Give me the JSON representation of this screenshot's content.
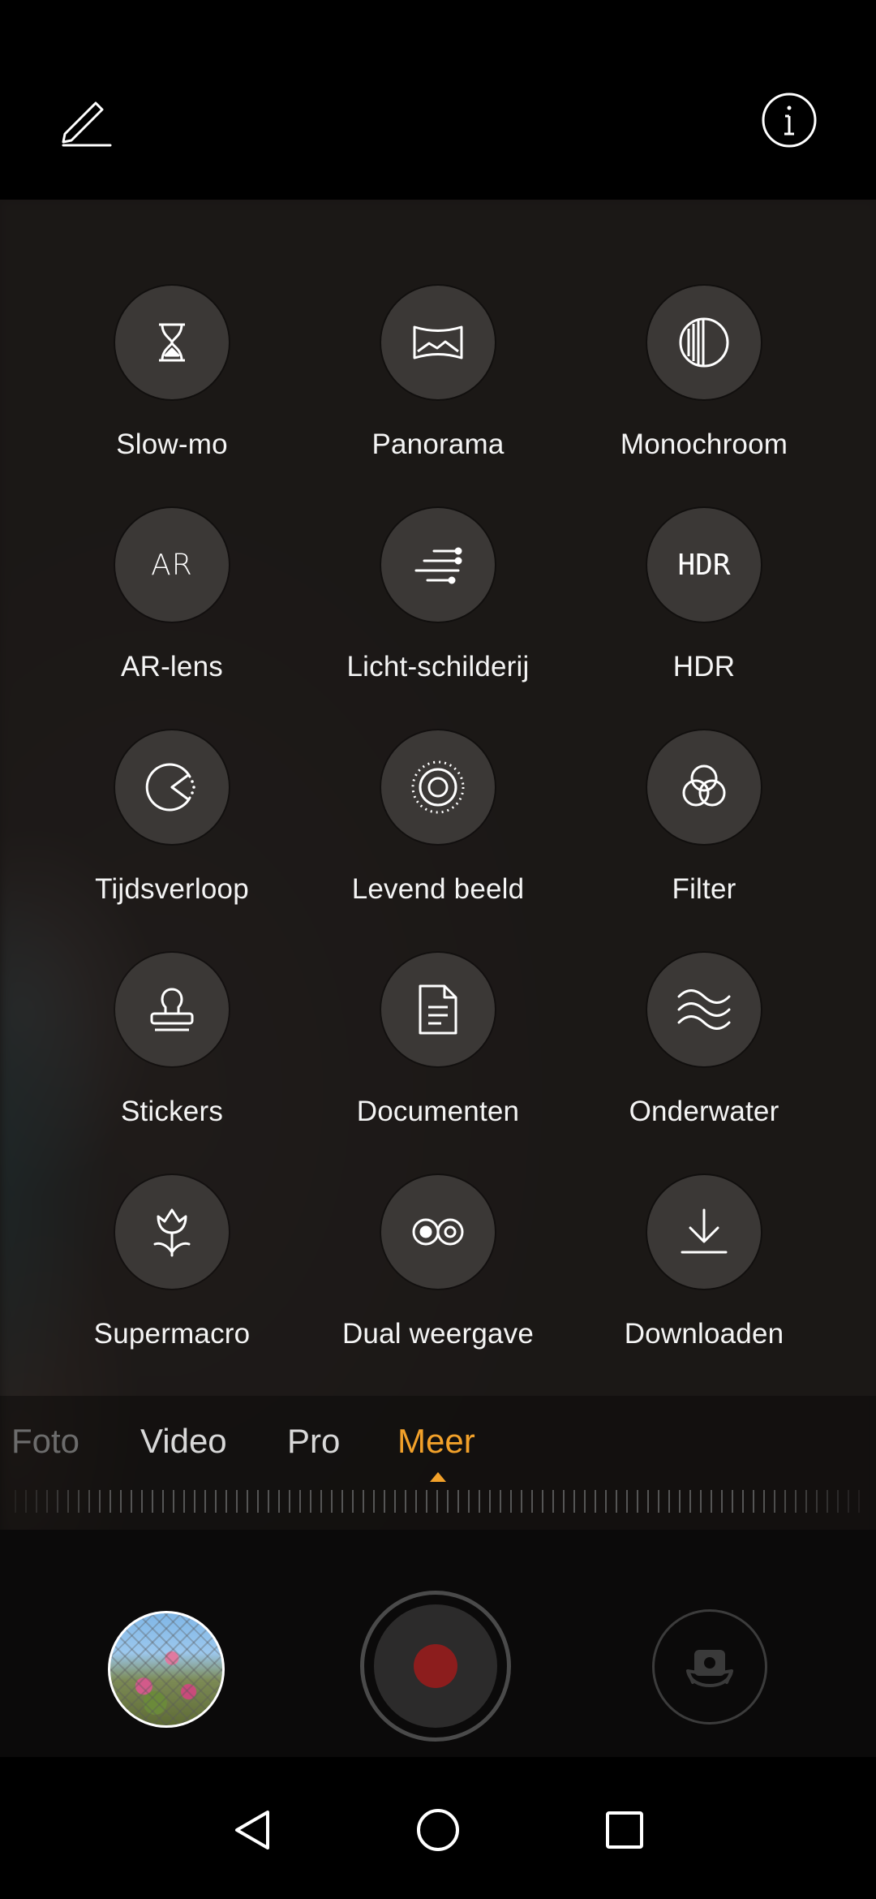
{
  "top_bar": {
    "edit_icon": "pencil-icon",
    "info_icon": "info-icon"
  },
  "modes": [
    {
      "label": "Slow-mo",
      "icon": "hourglass-icon"
    },
    {
      "label": "Panorama",
      "icon": "panorama-icon"
    },
    {
      "label": "Monochroom",
      "icon": "monochrome-icon"
    },
    {
      "label": "AR-lens",
      "icon": "ar-icon"
    },
    {
      "label": "Licht-schilderij",
      "icon": "light-trails-icon"
    },
    {
      "label": "HDR",
      "icon": "hdr-icon"
    },
    {
      "label": "Tijdsverloop",
      "icon": "timelapse-icon"
    },
    {
      "label": "Levend beeld",
      "icon": "live-photo-icon"
    },
    {
      "label": "Filter",
      "icon": "filter-circles-icon"
    },
    {
      "label": "Stickers",
      "icon": "stamp-icon"
    },
    {
      "label": "Documenten",
      "icon": "document-icon"
    },
    {
      "label": "Onderwater",
      "icon": "waves-icon"
    },
    {
      "label": "Supermacro",
      "icon": "flower-icon"
    },
    {
      "label": "Dual weergave",
      "icon": "dual-view-icon"
    },
    {
      "label": "Downloaden",
      "icon": "download-icon"
    }
  ],
  "icon_texts": {
    "ar": "AR",
    "hdr": "HDR"
  },
  "tabs": [
    {
      "label": "Foto",
      "state": "faded"
    },
    {
      "label": "Video",
      "state": "normal"
    },
    {
      "label": "Pro",
      "state": "normal"
    },
    {
      "label": "Meer",
      "state": "active"
    }
  ],
  "colors": {
    "accent": "#f2a12a",
    "record": "#8c1d1d",
    "mode_circle": "#3b3836"
  },
  "controls": {
    "gallery": "gallery-thumbnail",
    "shutter": "video-record-button",
    "switch": "switch-camera-icon"
  },
  "nav": {
    "back": "back-triangle-icon",
    "home": "home-circle-icon",
    "recents": "recents-square-icon"
  }
}
